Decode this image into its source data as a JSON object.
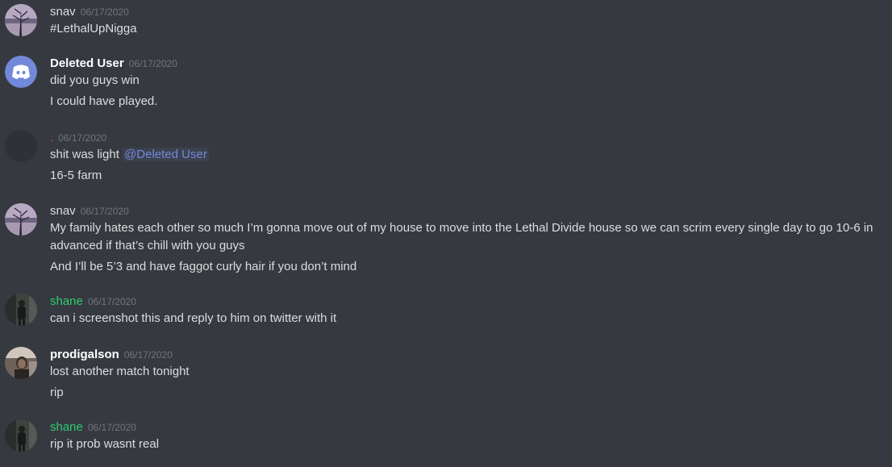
{
  "messages": [
    {
      "username": "snav",
      "timestamp": "06/17/2020",
      "lines": [
        "#LethalUpNigga"
      ]
    },
    {
      "username": "Deleted User",
      "timestamp": "06/17/2020",
      "lines": [
        "did you guys win",
        "I could have played."
      ]
    },
    {
      "username": ".",
      "timestamp": "06/17/2020",
      "lines": [
        {
          "text": "shit was light ",
          "mention": "@Deleted User"
        },
        "16-5 farm"
      ]
    },
    {
      "username": "snav",
      "timestamp": "06/17/2020",
      "lines": [
        "My family hates each other so much I’m gonna move out of my house to move into the Lethal Divide house so we can scrim every single day to go 10-6 in advanced if that’s chill with you guys",
        "And I’ll be 5’3 and have faggot curly hair if you don’t mind"
      ]
    },
    {
      "username": "shane",
      "timestamp": "06/17/2020",
      "lines": [
        "can i screenshot this and reply to him on twitter with it"
      ]
    },
    {
      "username": "prodigalson",
      "timestamp": "06/17/2020",
      "lines": [
        "lost another match tonight",
        "rip"
      ]
    },
    {
      "username": "shane",
      "timestamp": "06/17/2020",
      "lines": [
        "rip it prob wasnt real"
      ]
    }
  ],
  "colors": {
    "background": "#36393f",
    "text": "#dcddde",
    "timestamp": "#72767d",
    "username_green": "#2ecc71",
    "username_red": "#e74c3c",
    "mention": "#7289da",
    "discord_blurple": "#7289da"
  }
}
